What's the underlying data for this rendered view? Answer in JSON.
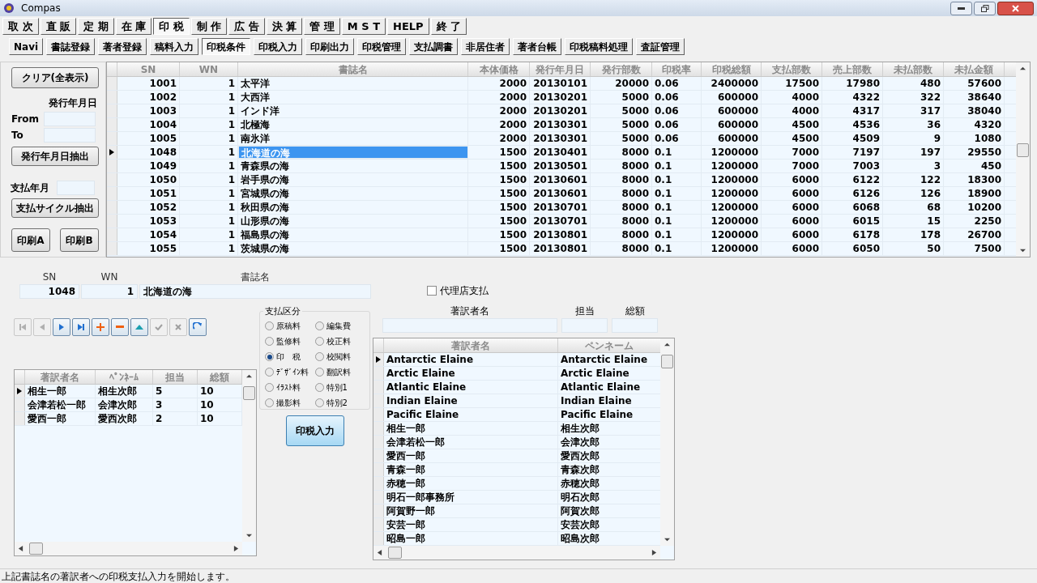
{
  "window": {
    "title": "Compas"
  },
  "menu": [
    {
      "label": "取 次",
      "selected": false
    },
    {
      "label": "直 販",
      "selected": false
    },
    {
      "label": "定 期",
      "selected": false
    },
    {
      "label": "在 庫",
      "selected": false
    },
    {
      "label": "印 税",
      "selected": true
    },
    {
      "label": "制 作",
      "selected": false
    },
    {
      "label": "広 告",
      "selected": false
    },
    {
      "label": "決 算",
      "selected": false
    },
    {
      "label": "管 理",
      "selected": false
    },
    {
      "label": "M S T",
      "selected": false
    },
    {
      "label": "HELP",
      "selected": false
    },
    {
      "label": "終 了",
      "selected": false
    }
  ],
  "subtabs": [
    {
      "label": "Navi",
      "selected": false
    },
    {
      "label": "書誌登録",
      "selected": false
    },
    {
      "label": "著者登録",
      "selected": false
    },
    {
      "label": "稿料入力",
      "selected": false
    },
    {
      "label": "印税条件",
      "selected": true
    },
    {
      "label": "印税入力",
      "selected": false
    },
    {
      "label": "印刷出力",
      "selected": false
    },
    {
      "label": "印税管理",
      "selected": false
    },
    {
      "label": "支払調書",
      "selected": false
    },
    {
      "label": "非居住者",
      "selected": false
    },
    {
      "label": "著者台帳",
      "selected": false
    },
    {
      "label": "印税稿料処理",
      "selected": false
    },
    {
      "label": "査証管理",
      "selected": false
    }
  ],
  "filter_panel": {
    "clear_button": "クリア(全表示)",
    "date_label": "発行年月日",
    "from_label": "From",
    "to_label": "To",
    "date_button": "発行年月日抽出",
    "pay_month_label": "支払年月",
    "cycle_button": "支払サイクル抽出",
    "print_a": "印刷A",
    "print_b": "印刷B"
  },
  "table": {
    "columns": [
      "SN",
      "WN",
      "書誌名",
      "本体価格",
      "発行年月日",
      "発行部数",
      "印税率",
      "印税総額",
      "支払部数",
      "売上部数",
      "未払部数",
      "未払金額"
    ],
    "rows": [
      {
        "selected": false,
        "cells": [
          "1001",
          "1",
          "太平洋",
          "2000",
          "20130101",
          "20000",
          "0.06",
          "2400000",
          "17500",
          "17980",
          "480",
          "57600"
        ]
      },
      {
        "selected": false,
        "cells": [
          "1002",
          "1",
          "大西洋",
          "2000",
          "20130201",
          "5000",
          "0.06",
          "600000",
          "4000",
          "4322",
          "322",
          "38640"
        ]
      },
      {
        "selected": false,
        "cells": [
          "1003",
          "1",
          "インド洋",
          "2000",
          "20130201",
          "5000",
          "0.06",
          "600000",
          "4000",
          "4317",
          "317",
          "38040"
        ]
      },
      {
        "selected": false,
        "cells": [
          "1004",
          "1",
          "北極海",
          "2000",
          "20130301",
          "5000",
          "0.06",
          "600000",
          "4500",
          "4536",
          "36",
          "4320"
        ]
      },
      {
        "selected": false,
        "cells": [
          "1005",
          "1",
          "南氷洋",
          "2000",
          "20130301",
          "5000",
          "0.06",
          "600000",
          "4500",
          "4509",
          "9",
          "1080"
        ]
      },
      {
        "selected": true,
        "cells": [
          "1048",
          "1",
          "北海道の海",
          "1500",
          "20130401",
          "8000",
          "0.1",
          "1200000",
          "7000",
          "7197",
          "197",
          "29550"
        ]
      },
      {
        "selected": false,
        "cells": [
          "1049",
          "1",
          "青森県の海",
          "1500",
          "20130501",
          "8000",
          "0.1",
          "1200000",
          "7000",
          "7003",
          "3",
          "450"
        ]
      },
      {
        "selected": false,
        "cells": [
          "1050",
          "1",
          "岩手県の海",
          "1500",
          "20130601",
          "8000",
          "0.1",
          "1200000",
          "6000",
          "6122",
          "122",
          "18300"
        ]
      },
      {
        "selected": false,
        "cells": [
          "1051",
          "1",
          "宮城県の海",
          "1500",
          "20130601",
          "8000",
          "0.1",
          "1200000",
          "6000",
          "6126",
          "126",
          "18900"
        ]
      },
      {
        "selected": false,
        "cells": [
          "1052",
          "1",
          "秋田県の海",
          "1500",
          "20130701",
          "8000",
          "0.1",
          "1200000",
          "6000",
          "6068",
          "68",
          "10200"
        ]
      },
      {
        "selected": false,
        "cells": [
          "1053",
          "1",
          "山形県の海",
          "1500",
          "20130701",
          "8000",
          "0.1",
          "1200000",
          "6000",
          "6015",
          "15",
          "2250"
        ]
      },
      {
        "selected": false,
        "cells": [
          "1054",
          "1",
          "福島県の海",
          "1500",
          "20130801",
          "8000",
          "0.1",
          "1200000",
          "6000",
          "6178",
          "178",
          "26700"
        ]
      },
      {
        "selected": false,
        "cells": [
          "1055",
          "1",
          "茨城県の海",
          "1500",
          "20130801",
          "8000",
          "0.1",
          "1200000",
          "6000",
          "6050",
          "50",
          "7500"
        ]
      }
    ]
  },
  "detail": {
    "sn_label": "SN",
    "wn_label": "WN",
    "title_label": "書誌名",
    "sn": "1048",
    "wn": "1",
    "title": "北海道の海"
  },
  "agency_payment": {
    "label": "代理店支払",
    "checked": false
  },
  "navigator": [
    {
      "kind": "first",
      "disabled": true
    },
    {
      "kind": "prior",
      "disabled": true
    },
    {
      "kind": "next",
      "disabled": false
    },
    {
      "kind": "last",
      "disabled": false
    },
    {
      "kind": "insert",
      "disabled": false
    },
    {
      "kind": "delete",
      "disabled": false
    },
    {
      "kind": "edit",
      "disabled": false
    },
    {
      "kind": "post",
      "disabled": true
    },
    {
      "kind": "cancel",
      "disabled": true
    },
    {
      "kind": "refresh",
      "disabled": false
    }
  ],
  "payment_type": {
    "title": "支払区分",
    "options": [
      {
        "label": "原稿料",
        "selected": false
      },
      {
        "label": "編集費",
        "selected": false
      },
      {
        "label": "監修料",
        "selected": false
      },
      {
        "label": "校正料",
        "selected": false
      },
      {
        "label": "印　税",
        "selected": true
      },
      {
        "label": "校閲料",
        "selected": false
      },
      {
        "label": "ﾃﾞｻﾞｲﾝ料",
        "selected": false
      },
      {
        "label": "翻訳料",
        "selected": false
      },
      {
        "label": "ｲﾗｽﾄ料",
        "selected": false
      },
      {
        "label": "特別1",
        "selected": false
      },
      {
        "label": "撮影料",
        "selected": false
      },
      {
        "label": "特別2",
        "selected": false
      }
    ]
  },
  "royalty_button": "印税入力",
  "author_grid": {
    "columns": [
      "著訳者名",
      "ﾍﾟﾝﾈｰﾑ",
      "担当",
      "総額"
    ],
    "rows": [
      {
        "selected": true,
        "cells": [
          "相生一郎",
          "相生次郎",
          "5",
          "10"
        ]
      },
      {
        "selected": false,
        "cells": [
          "会津若松一郎",
          "会津次郎",
          "3",
          "10"
        ]
      },
      {
        "selected": false,
        "cells": [
          "愛西一郎",
          "愛西次郎",
          "2",
          "10"
        ]
      }
    ]
  },
  "author_fields": {
    "name_label": "著訳者名",
    "charge_label": "担当",
    "total_label": "総額"
  },
  "author_list": {
    "columns": [
      "著訳者名",
      "ペンネーム"
    ],
    "rows": [
      {
        "selected": true,
        "cells": [
          "Antarctic Elaine",
          "Antarctic Elaine"
        ]
      },
      {
        "selected": false,
        "cells": [
          "Arctic Elaine",
          "Arctic Elaine"
        ]
      },
      {
        "selected": false,
        "cells": [
          "Atlantic Elaine",
          "Atlantic Elaine"
        ]
      },
      {
        "selected": false,
        "cells": [
          "Indian Elaine",
          "Indian Elaine"
        ]
      },
      {
        "selected": false,
        "cells": [
          "Pacific Elaine",
          "Pacific Elaine"
        ]
      },
      {
        "selected": false,
        "cells": [
          "相生一郎",
          "相生次郎"
        ]
      },
      {
        "selected": false,
        "cells": [
          "会津若松一郎",
          "会津次郎"
        ]
      },
      {
        "selected": false,
        "cells": [
          "愛西一郎",
          "愛西次郎"
        ]
      },
      {
        "selected": false,
        "cells": [
          "青森一郎",
          "青森次郎"
        ]
      },
      {
        "selected": false,
        "cells": [
          "赤穂一郎",
          "赤穂次郎"
        ]
      },
      {
        "selected": false,
        "cells": [
          "明石一郎事務所",
          "明石次郎"
        ]
      },
      {
        "selected": false,
        "cells": [
          "阿賀野一郎",
          "阿賀次郎"
        ]
      },
      {
        "selected": false,
        "cells": [
          "安芸一郎",
          "安芸次郎"
        ]
      },
      {
        "selected": false,
        "cells": [
          "昭島一郎",
          "昭島次郎"
        ]
      }
    ]
  },
  "status_bar": "上記書誌名の著訳者への印税支払入力を開始します。"
}
